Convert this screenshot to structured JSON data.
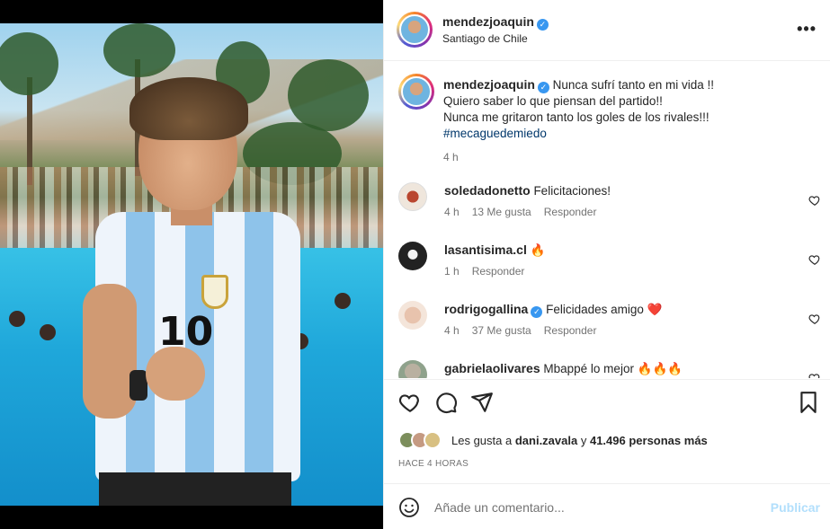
{
  "post": {
    "username": "mendezjoaquin",
    "location": "Santiago de Chile",
    "more_label": "•••"
  },
  "caption": {
    "username": "mendezjoaquin",
    "lines": [
      "Nunca sufrí tanto en mi vida !!",
      "Quiero saber lo que piensan del partido!!",
      "Nunca me gritaron tanto los goles de los rivales!!!"
    ],
    "hashtag": "#mecaguedemiedo",
    "time": "4 h"
  },
  "comments": [
    {
      "username": "soledadonetto",
      "verified": false,
      "text": "Felicitaciones!",
      "time": "4 h",
      "likes": "13 Me gusta",
      "reply": "Responder"
    },
    {
      "username": "lasantisima.cl",
      "verified": false,
      "text": "🔥",
      "time": "1 h",
      "likes": "",
      "reply": "Responder"
    },
    {
      "username": "rodrigogallina",
      "verified": true,
      "text": "Felicidades amigo",
      "emoji": "❤️",
      "time": "4 h",
      "likes": "37 Me gusta",
      "reply": "Responder"
    },
    {
      "username": "gabrielaolivares",
      "verified": false,
      "text": "Mbappé lo mejor",
      "emoji": "🔥🔥🔥"
    }
  ],
  "likes": {
    "prefix": "Les gusta a",
    "user": "dani.zavala",
    "connector": "y",
    "count": "41.496 personas más"
  },
  "timestamp": "HACE 4 HORAS",
  "composer": {
    "placeholder": "Añade un comentario...",
    "publish": "Publicar"
  },
  "colors": {
    "accent": "#0095f6",
    "verified": "#3897f0",
    "hashtag": "#00376b",
    "publish_disabled": "#b2dffc"
  }
}
